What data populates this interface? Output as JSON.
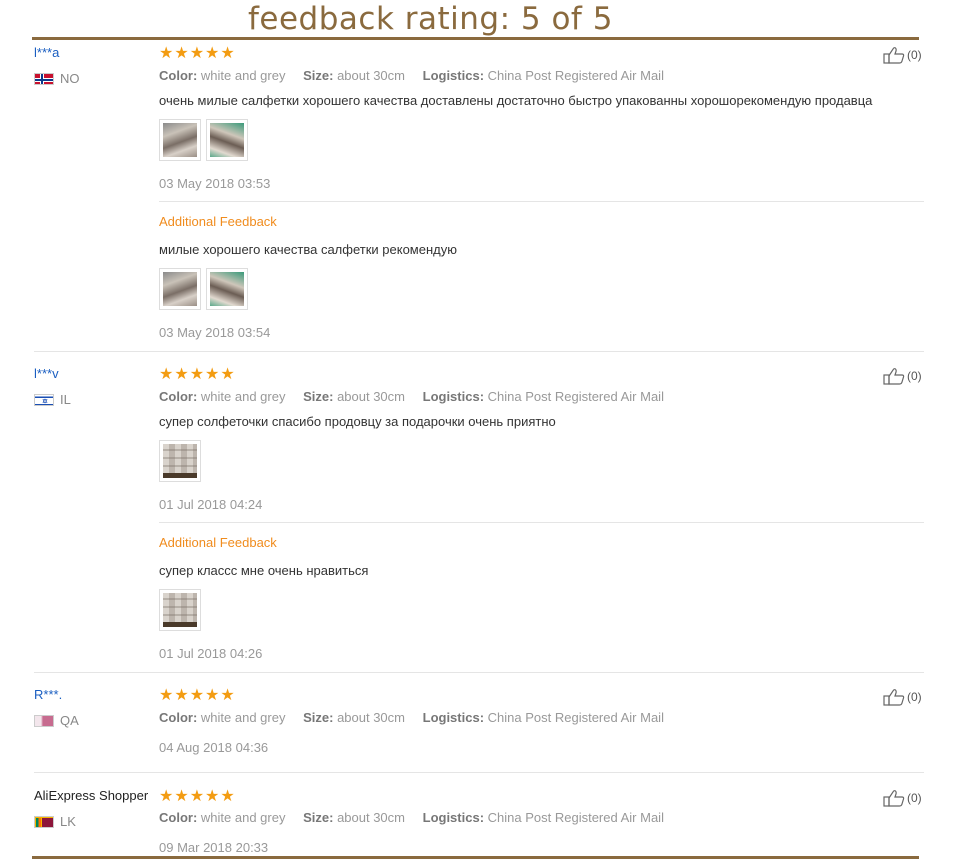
{
  "banner": {
    "title": "feedback rating: 5 of 5"
  },
  "labels": {
    "color": "Color:",
    "size": "Size:",
    "logistics": "Logistics:",
    "additional": "Additional Feedback"
  },
  "colors": {
    "accent": "#8a6a3e",
    "star": "#f39c12",
    "link": "#1a5ec1",
    "additional": "#f08c1e"
  },
  "reviews": [
    {
      "user": "l***a",
      "country": "NO",
      "stars": 5,
      "color": "white and grey",
      "size": "about 30cm",
      "logistics": "China Post Registered Air Mail",
      "text": "очень милые салфетки хорошего качества доставлены достаточно быстро упакованны хорошорекомендую продавца",
      "date": "03 May 2018 03:53",
      "helpful": "(0)",
      "additional": {
        "text": "милые хорошего качества салфетки рекомендую",
        "date": "03 May 2018 03:54"
      }
    },
    {
      "user": "l***v",
      "country": "IL",
      "stars": 5,
      "color": "white and grey",
      "size": "about 30cm",
      "logistics": "China Post Registered Air Mail",
      "text": "супер солфеточки спасибо продовцу за подарочки очень приятно",
      "date": "01 Jul 2018 04:24",
      "helpful": "(0)",
      "additional": {
        "text": "супер классс мне очень нравиться",
        "date": "01 Jul 2018 04:26"
      }
    },
    {
      "user": "R***.",
      "country": "QA",
      "stars": 5,
      "color": "white and grey",
      "size": "about 30cm",
      "logistics": "China Post Registered Air Mail",
      "date": "04 Aug 2018 04:36",
      "helpful": "(0)"
    },
    {
      "user": "AliExpress Shopper",
      "country": "LK",
      "stars": 5,
      "color": "white and grey",
      "size": "about 30cm",
      "logistics": "China Post Registered Air Mail",
      "date": "09 Mar 2018 20:33",
      "helpful": "(0)"
    }
  ]
}
